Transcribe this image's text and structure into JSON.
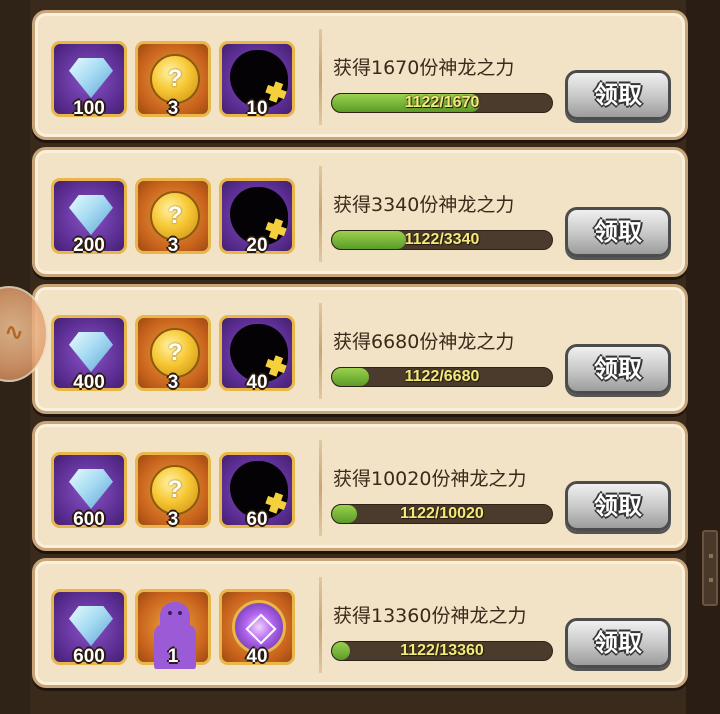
{
  "rewards": [
    {
      "title": "获得1670份神龙之力",
      "progress_text": "1122/1670",
      "progress_fraction": 0.672,
      "claim_label": "领取",
      "items": [
        {
          "type": "gem",
          "icon": "crystal-icon",
          "count": "100"
        },
        {
          "type": "coin",
          "icon": "mystery-coin-icon",
          "symbol": "?",
          "count": "3"
        },
        {
          "type": "shadow",
          "icon": "locked-silhouette-icon",
          "count": "10"
        }
      ]
    },
    {
      "title": "获得3340份神龙之力",
      "progress_text": "1122/3340",
      "progress_fraction": 0.336,
      "claim_label": "领取",
      "items": [
        {
          "type": "gem",
          "icon": "crystal-icon",
          "count": "200"
        },
        {
          "type": "coin",
          "icon": "mystery-coin-icon",
          "symbol": "?",
          "count": "3"
        },
        {
          "type": "shadow",
          "icon": "locked-silhouette-icon",
          "count": "20"
        }
      ]
    },
    {
      "title": "获得6680份神龙之力",
      "progress_text": "1122/6680",
      "progress_fraction": 0.168,
      "claim_label": "领取",
      "items": [
        {
          "type": "gem",
          "icon": "crystal-icon",
          "count": "400"
        },
        {
          "type": "coin",
          "icon": "mystery-coin-icon",
          "symbol": "?",
          "count": "3"
        },
        {
          "type": "shadow",
          "icon": "locked-silhouette-icon",
          "count": "40"
        }
      ]
    },
    {
      "title": "获得10020份神龙之力",
      "progress_text": "1122/10020",
      "progress_fraction": 0.112,
      "claim_label": "领取",
      "items": [
        {
          "type": "gem",
          "icon": "crystal-icon",
          "count": "600"
        },
        {
          "type": "coin",
          "icon": "mystery-coin-icon",
          "symbol": "?",
          "count": "3"
        },
        {
          "type": "shadow",
          "icon": "locked-silhouette-icon",
          "count": "60"
        }
      ]
    },
    {
      "title": "获得13360份神龙之力",
      "progress_text": "1122/13360",
      "progress_fraction": 0.084,
      "claim_label": "领取",
      "items": [
        {
          "type": "gem",
          "icon": "crystal-icon",
          "count": "600"
        },
        {
          "type": "cookie",
          "icon": "gingerbread-cookie-icon",
          "count": "1"
        },
        {
          "type": "emblem",
          "icon": "magic-emblem-icon",
          "count": "40"
        }
      ]
    }
  ],
  "colors": {
    "card_bg": "#f2e2c6",
    "card_border": "#c7a579",
    "progress_fill": "#7bbd3a",
    "progress_text": "#f2ea7a",
    "button": "#c6c6c6"
  }
}
